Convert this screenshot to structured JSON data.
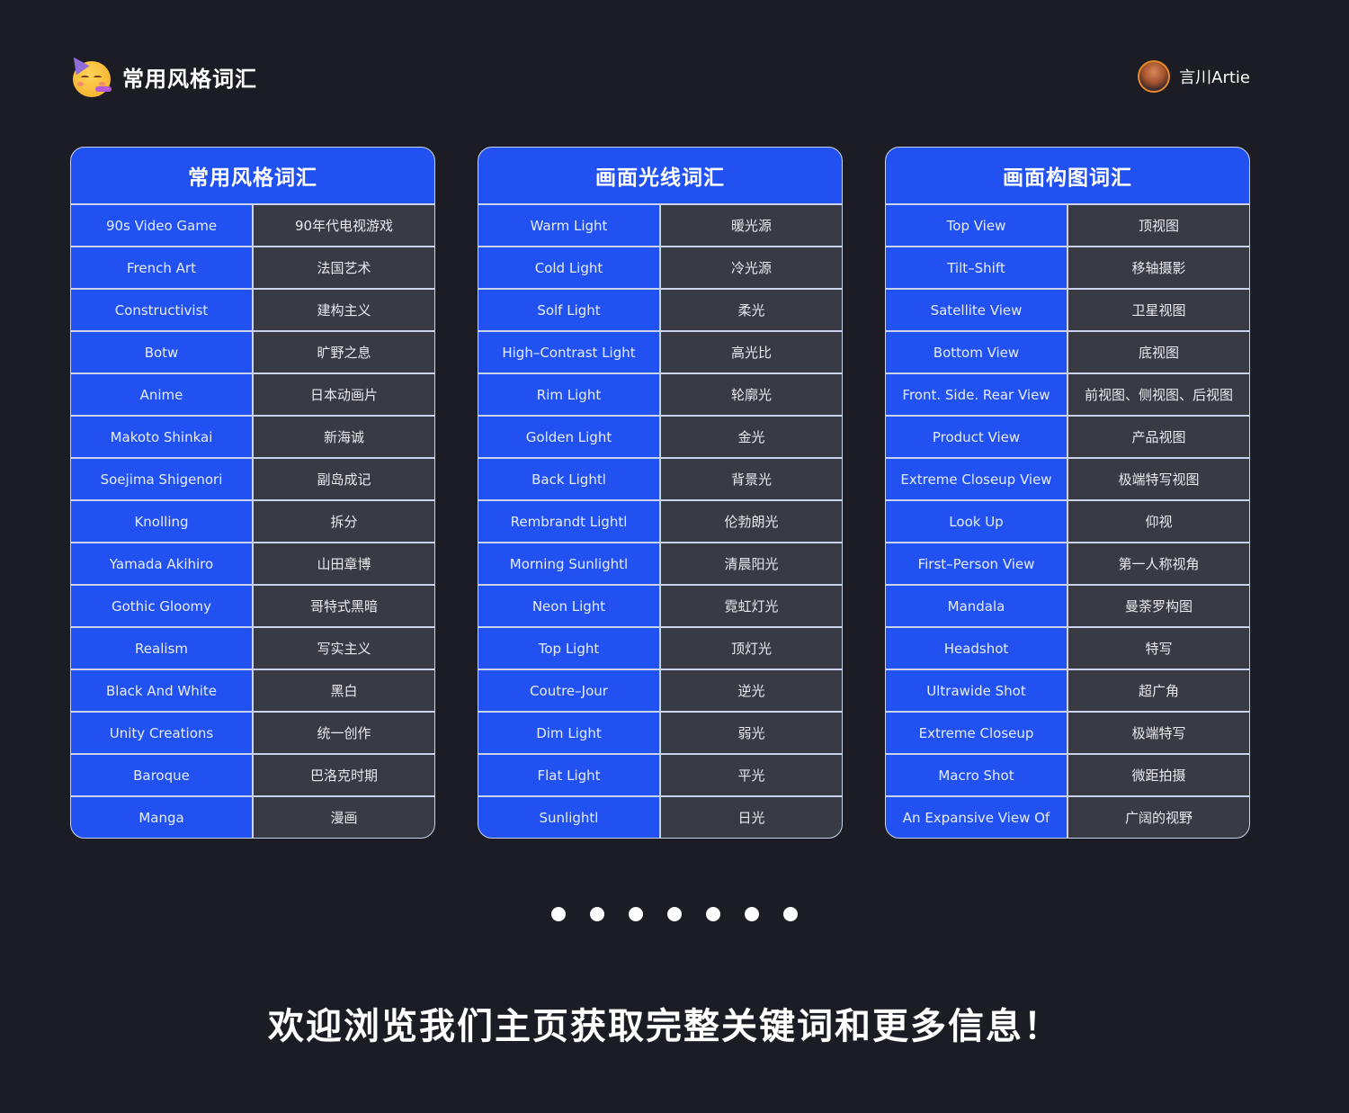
{
  "header": {
    "title": "常用风格词汇",
    "logo_icon": "party-face-emoji",
    "author": "言川Artie",
    "avatar_icon": "avatar"
  },
  "tables": [
    {
      "title": "常用风格词汇",
      "rows": [
        {
          "en": "90s Video Game",
          "zh": "90年代电视游戏"
        },
        {
          "en": "French Art",
          "zh": "法国艺术"
        },
        {
          "en": "Constructivist",
          "zh": "建构主义"
        },
        {
          "en": "Botw",
          "zh": "旷野之息"
        },
        {
          "en": "Anime",
          "zh": "日本动画片"
        },
        {
          "en": "Makoto Shinkai",
          "zh": "新海诚"
        },
        {
          "en": "Soejima Shigenori",
          "zh": "副岛成记"
        },
        {
          "en": "Knolling",
          "zh": "拆分"
        },
        {
          "en": "Yamada Akihiro",
          "zh": "山田章博"
        },
        {
          "en": "Gothic Gloomy",
          "zh": "哥特式黑暗"
        },
        {
          "en": "Realism",
          "zh": "写实主义"
        },
        {
          "en": "Black And White",
          "zh": "黑白"
        },
        {
          "en": "Unity Creations",
          "zh": "统一创作"
        },
        {
          "en": "Baroque",
          "zh": "巴洛克时期"
        },
        {
          "en": "Manga",
          "zh": "漫画"
        }
      ]
    },
    {
      "title": "画面光线词汇",
      "rows": [
        {
          "en": "Warm Light",
          "zh": "暖光源"
        },
        {
          "en": "Cold Light",
          "zh": "冷光源"
        },
        {
          "en": "Solf Light",
          "zh": "柔光"
        },
        {
          "en": "High–Contrast Light",
          "zh": "高光比"
        },
        {
          "en": "Rim Light",
          "zh": "轮廓光"
        },
        {
          "en": "Golden Light",
          "zh": "金光"
        },
        {
          "en": "Back Lightl",
          "zh": "背景光"
        },
        {
          "en": "Rembrandt Lightl",
          "zh": "伦勃朗光"
        },
        {
          "en": "Morning Sunlightl",
          "zh": "清晨阳光"
        },
        {
          "en": "Neon Light",
          "zh": "霓虹灯光"
        },
        {
          "en": "Top Light",
          "zh": "顶灯光"
        },
        {
          "en": "Coutre–Jour",
          "zh": "逆光"
        },
        {
          "en": "Dim Light",
          "zh": "弱光"
        },
        {
          "en": "Flat Light",
          "zh": "平光"
        },
        {
          "en": "Sunlightl",
          "zh": "日光"
        }
      ]
    },
    {
      "title": "画面构图词汇",
      "rows": [
        {
          "en": "Top View",
          "zh": "顶视图"
        },
        {
          "en": "Tilt–Shift",
          "zh": "移轴摄影"
        },
        {
          "en": "Satellite View",
          "zh": "卫星视图"
        },
        {
          "en": "Bottom View",
          "zh": "底视图"
        },
        {
          "en": "Front. Side. Rear View",
          "zh": "前视图、侧视图、后视图"
        },
        {
          "en": "Product View",
          "zh": "产品视图"
        },
        {
          "en": "Extreme Closeup View",
          "zh": "极端特写视图"
        },
        {
          "en": "Look Up",
          "zh": "仰视"
        },
        {
          "en": "First–Person View",
          "zh": "第一人称视角"
        },
        {
          "en": "Mandala",
          "zh": "曼荼罗构图"
        },
        {
          "en": "Headshot",
          "zh": "特写"
        },
        {
          "en": "Ultrawide Shot",
          "zh": "超广角"
        },
        {
          "en": "Extreme Closeup",
          "zh": "极端特写"
        },
        {
          "en": "Macro Shot",
          "zh": "微距拍摄"
        },
        {
          "en": "An Expansive View Of",
          "zh": "广阔的视野"
        }
      ]
    }
  ],
  "pagination": {
    "count": 7
  },
  "footer": {
    "text": "欢迎浏览我们主页获取完整关键词和更多信息！"
  },
  "colors": {
    "background": "#1b1c24",
    "accent_blue": "#2251f2",
    "cell_dark": "#393b44",
    "border": "#c9d3ee"
  }
}
